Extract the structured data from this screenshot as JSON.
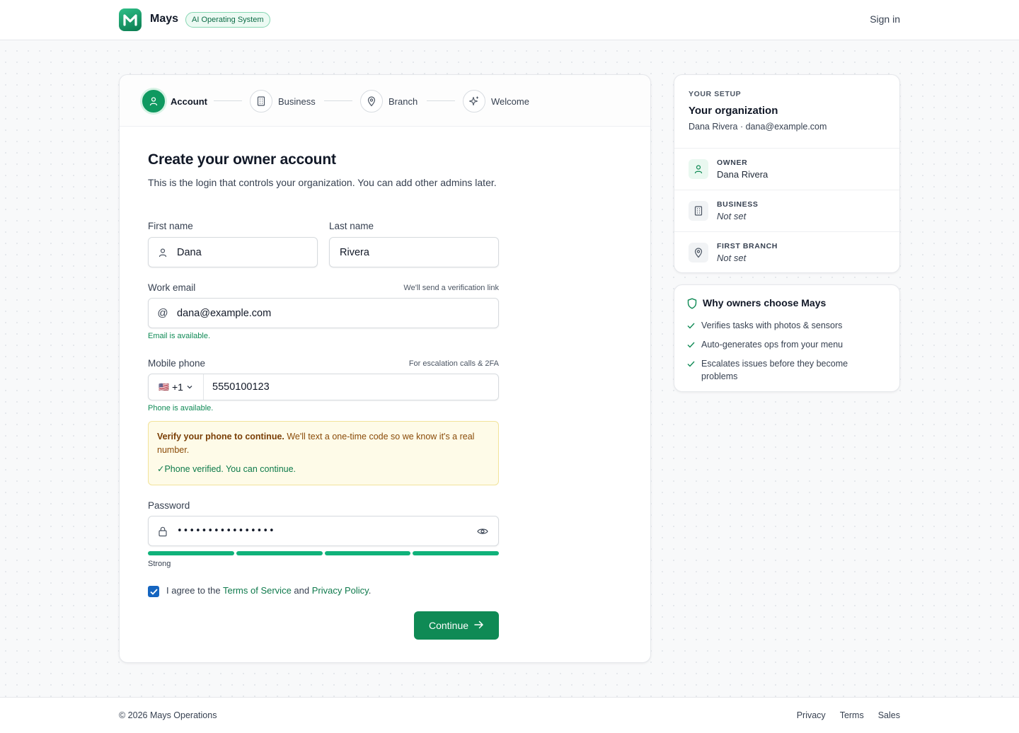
{
  "header": {
    "brand": "Mays",
    "tag": "AI Operating System",
    "signin": "Sign in"
  },
  "steps": [
    {
      "label": "Account",
      "icon": "user-icon",
      "active": true
    },
    {
      "label": "Business",
      "icon": "building-icon",
      "active": false
    },
    {
      "label": "Branch",
      "icon": "map-pin-icon",
      "active": false
    },
    {
      "label": "Welcome",
      "icon": "sparkle-icon",
      "active": false
    }
  ],
  "form": {
    "title": "Create your owner account",
    "subtitle": "This is the login that controls your organization. You can add other admins later.",
    "first_name": {
      "label": "First name",
      "value": "Dana"
    },
    "last_name": {
      "label": "Last name",
      "value": "Rivera"
    },
    "email": {
      "label": "Work email",
      "hint": "We'll send a verification link",
      "value": "dana@example.com",
      "status": "Email is available."
    },
    "phone": {
      "label": "Mobile phone",
      "hint": "For escalation calls & 2FA",
      "country_code": "+1",
      "flag": "🇺🇸",
      "value": "5550100123",
      "status": "Phone is available."
    },
    "verify": {
      "bold": "Verify your phone to continue.",
      "text": " We'll text a one-time code so we know it's a real number.",
      "done": "✓Phone verified. You can continue."
    },
    "password": {
      "label": "Password",
      "value": "••••••••••••••••",
      "strength_label": "Strong",
      "strength_fraction": 1.0
    },
    "agree": {
      "prefix": "I agree to the ",
      "terms": "Terms of Service",
      "and": " and ",
      "privacy": "Privacy Policy",
      "suffix": ".",
      "checked": true
    },
    "continue": "Continue"
  },
  "setup": {
    "eyebrow": "YOUR SETUP",
    "org": "Your organization",
    "who": "Dana Rivera · dana@example.com",
    "rows": [
      {
        "key": "OWNER",
        "value": "Dana Rivera"
      },
      {
        "key": "BUSINESS",
        "value": "Not set"
      },
      {
        "key": "FIRST BRANCH",
        "value": "Not set"
      }
    ]
  },
  "why": {
    "title": "Why owners choose Mays",
    "items": [
      "Verifies tasks with photos & sensors",
      "Auto-generates ops from your menu",
      "Escalates issues before they become problems"
    ]
  },
  "footer": {
    "copy": "© 2026 Mays Operations",
    "links": [
      "Privacy",
      "Terms",
      "Sales"
    ]
  },
  "colors": {
    "accent": "#0f8a55",
    "accent_light": "#ecfaf3",
    "warning_bg": "#fefbe8",
    "checkbox": "#1565c0"
  }
}
